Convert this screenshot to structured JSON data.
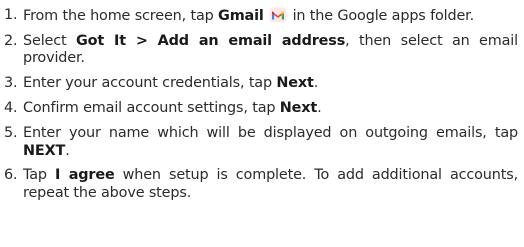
{
  "steps": [
    {
      "number": "1.",
      "pre": "From the home screen, tap ",
      "bold": "Gmail",
      "icon": "gmail-icon",
      "post": " in the Google apps folder."
    },
    {
      "number": "2.",
      "pre": "Select ",
      "bold": "Got It > Add an email address",
      "post": ", then select an email provider."
    },
    {
      "number": "3.",
      "pre": "Enter your account credentials, tap ",
      "bold": "Next",
      "post": "."
    },
    {
      "number": "4.",
      "pre": "Confirm email account settings, tap ",
      "bold": "Next",
      "post": "."
    },
    {
      "number": "5.",
      "pre": "Enter your name which will be displayed on outgoing emails, tap ",
      "bold": "NEXT",
      "post": "."
    },
    {
      "number": "6.",
      "pre": "Tap ",
      "bold": "I agree",
      "post": " when setup is complete. To add additional accounts, repeat the above steps."
    }
  ],
  "colors": {
    "text": "#2b2b2b",
    "gmail_red": "#ea4335",
    "gmail_blue": "#4285f4",
    "gmail_green": "#34a853",
    "gmail_yellow": "#fbbc04"
  }
}
